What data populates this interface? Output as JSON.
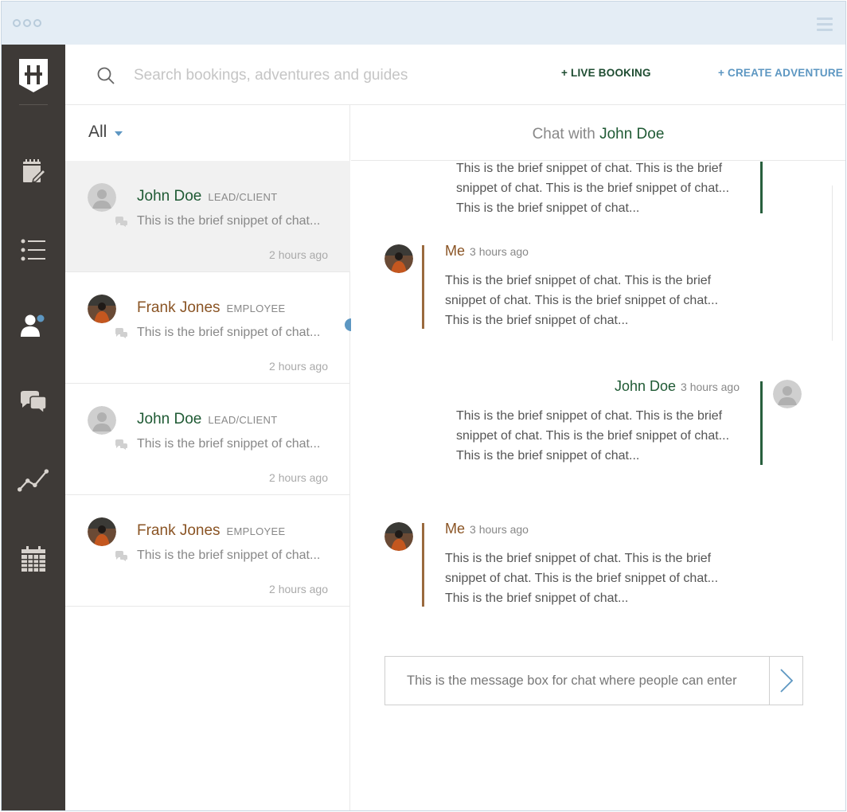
{
  "header": {
    "search_placeholder": "Search bookings, adventures and guides",
    "live_booking_label": "+ LIVE BOOKING",
    "create_adventure_label": "+ CREATE ADVENTURE"
  },
  "list": {
    "filter_label": "All",
    "contacts": [
      {
        "name": "John Doe",
        "role": "LEAD/CLIENT",
        "snippet": "This is the brief snippet of chat...",
        "time": "2 hours ago",
        "avatar": "placeholder"
      },
      {
        "name": "Frank Jones",
        "role": "EMPLOYEE",
        "snippet": "This is the brief snippet of chat...",
        "time": "2 hours ago",
        "avatar": "photo"
      },
      {
        "name": "John Doe",
        "role": "LEAD/CLIENT",
        "snippet": "This is the brief snippet of chat...",
        "time": "2 hours ago",
        "avatar": "placeholder"
      },
      {
        "name": "Frank Jones",
        "role": "EMPLOYEE",
        "snippet": "This is the brief snippet of chat...",
        "time": "2 hours ago",
        "avatar": "photo"
      }
    ]
  },
  "chat": {
    "title_prefix": "Chat with",
    "title_name": "John Doe",
    "messages": [
      {
        "sender": "",
        "time": "",
        "lines": [
          "This is the brief snippet of chat. This is the brief",
          "snippet of chat. This is the brief snippet of chat...",
          "This is the brief snippet of chat..."
        ]
      },
      {
        "sender": "Me",
        "time": "3 hours ago",
        "lines": [
          "This is the brief snippet of chat. This is the brief",
          "snippet of chat. This is the brief snippet of chat...",
          "This is the brief snippet of chat..."
        ]
      },
      {
        "sender": "John Doe",
        "time": "3 hours ago",
        "lines": [
          "This is the brief snippet of chat. This is the brief",
          "snippet of chat. This is the brief snippet of chat...",
          "This is the brief snippet of chat..."
        ]
      },
      {
        "sender": "Me",
        "time": "3 hours ago",
        "lines": [
          "This is the brief snippet of chat. This is the brief",
          "snippet of chat. This is the brief snippet of chat...",
          "This is the brief snippet of chat..."
        ]
      }
    ],
    "input_placeholder": "This is the message box for chat where people can enter"
  },
  "icons": {
    "logo": "logo-icon",
    "nav": [
      "notepad-icon",
      "list-icon",
      "users-icon",
      "chat-bubbles-icon",
      "analytics-icon",
      "calendar-icon"
    ],
    "search": "search-icon",
    "send": "chevron-right-icon"
  },
  "colors": {
    "sidebar": "#3e3a37",
    "accent_blue": "#5d97c2",
    "green": "#1f5a34",
    "brown": "#8a5424",
    "titlebar": "#e4edf5"
  }
}
